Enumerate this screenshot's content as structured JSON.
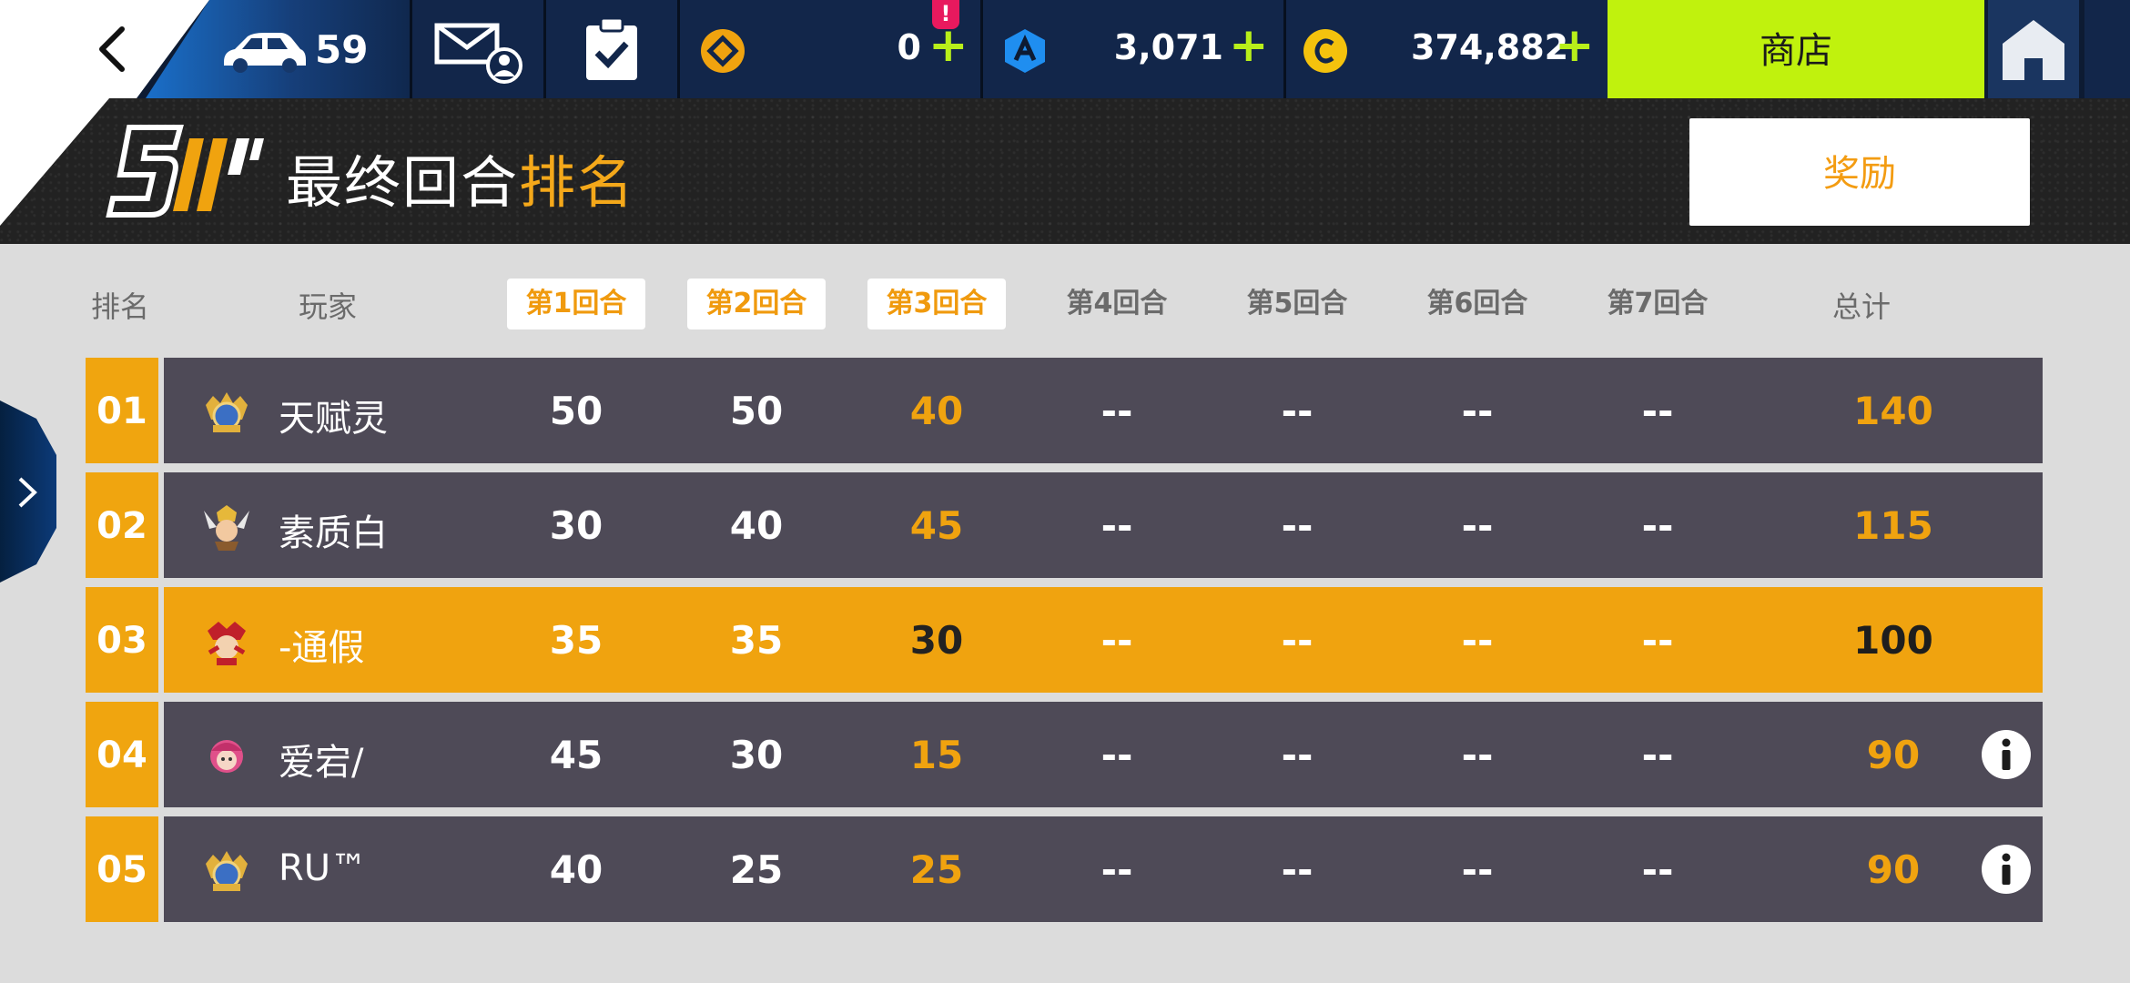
{
  "topbar": {
    "car_count": "59",
    "token_value": "0",
    "alert_badge": "!",
    "a_value": "3,071",
    "credits_value": "374,882",
    "plus": "+",
    "shop_label": "商店"
  },
  "header": {
    "title_main": "最终回合",
    "title_accent": "排名",
    "reward_label": "奖励"
  },
  "columns": {
    "rank": "排名",
    "player": "玩家",
    "rounds": [
      "第1回合",
      "第2回合",
      "第3回合",
      "第4回合",
      "第5回合",
      "第6回合",
      "第7回合"
    ],
    "total": "总计"
  },
  "rows": [
    {
      "rank": "01",
      "name": "天赋灵",
      "scores": [
        "50",
        "50",
        "40",
        "--",
        "--",
        "--",
        "--"
      ],
      "total": "140",
      "info": false
    },
    {
      "rank": "02",
      "name": "素质白",
      "scores": [
        "30",
        "40",
        "45",
        "--",
        "--",
        "--",
        "--"
      ],
      "total": "115",
      "info": false
    },
    {
      "rank": "03",
      "name": "-通假",
      "scores": [
        "35",
        "35",
        "30",
        "--",
        "--",
        "--",
        "--"
      ],
      "total": "100",
      "info": false,
      "highlight": true
    },
    {
      "rank": "04",
      "name": "爱宕/",
      "scores": [
        "45",
        "30",
        "15",
        "--",
        "--",
        "--",
        "--"
      ],
      "total": "90",
      "info": true
    },
    {
      "rank": "05",
      "name": "RU™",
      "scores": [
        "40",
        "25",
        "25",
        "--",
        "--",
        "--",
        "--"
      ],
      "total": "90",
      "info": true
    }
  ],
  "colors": {
    "accent_orange": "#f0a30f",
    "shop_green": "#c0f20d",
    "topbar_navy": "#12264a",
    "row_dark": "#4e4a57"
  },
  "icons": [
    "back-icon",
    "car-icon",
    "mail-icon",
    "clipboard-icon",
    "token-icon",
    "a-currency-icon",
    "c-currency-icon",
    "home-icon",
    "chevron-right-icon",
    "info-icon"
  ]
}
